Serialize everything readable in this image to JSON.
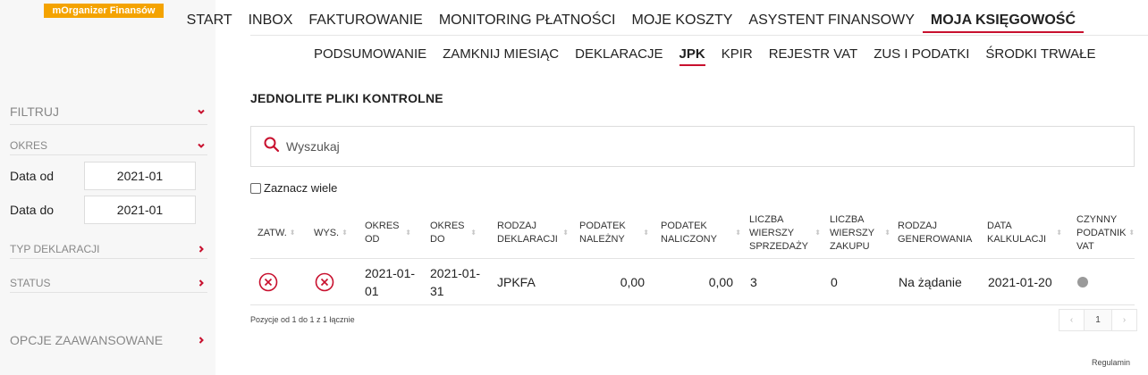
{
  "brand": {
    "logo_text": "mOrganizer Finansów",
    "accent": "#c8102e",
    "logo_color": "#f4a300"
  },
  "sidebar": {
    "filter_label": "FILTRUJ",
    "period_label": "OKRES",
    "date_from_label": "Data od",
    "date_from_value": "2021-01",
    "date_to_label": "Data do",
    "date_to_value": "2021-01",
    "decl_type_label": "TYP DEKLARACJI",
    "status_label": "STATUS",
    "advanced_label": "OPCJE ZAAWANSOWANE"
  },
  "topnav": {
    "items": [
      "START",
      "INBOX",
      "FAKTUROWANIE",
      "MONITORING PŁATNOŚCI",
      "MOJE KOSZTY",
      "ASYSTENT FINANSOWY",
      "MOJA KSIĘGOWOŚĆ"
    ],
    "active": "MOJA KSIĘGOWOŚĆ"
  },
  "subnav": {
    "items": [
      "PODSUMOWANIE",
      "ZAMKNIJ MIESIĄC",
      "DEKLARACJE",
      "JPK",
      "KPIR",
      "REJESTR VAT",
      "ZUS I PODATKI",
      "ŚRODKI TRWAŁE"
    ],
    "active": "JPK"
  },
  "page": {
    "title": "JEDNOLITE PLIKI KONTROLNE",
    "search_placeholder": "Wyszukaj",
    "multi_select_label": "Zaznacz wiele"
  },
  "table": {
    "headers": {
      "zatw": "ZATW.",
      "wys": "WYS.",
      "okres_od": "OKRES OD",
      "okres_do": "OKRES DO",
      "rodzaj": "RODZAJ DEKLARACJI",
      "nalezny": "PODATEK NALEŻNY",
      "naliczony": "PODATEK NALICZONY",
      "sprzedaz": "LICZBA WIERSZY SPRZEDAŻY",
      "zakup": "LICZBA WIERSZY ZAKUPU",
      "generowanie": "RODZAJ GENEROWANIA",
      "kalkulacja": "DATA KALKULACJI",
      "czynny": "CZYNNY PODATNIK VAT"
    },
    "rows": [
      {
        "zatw": "x-circle",
        "wys": "x-circle",
        "okres_od": "2021-01-01",
        "okres_do": "2021-01-31",
        "rodzaj": "JPKFA",
        "nalezny": "0,00",
        "naliczony": "0,00",
        "sprzedaz": "3",
        "zakup": "0",
        "generowanie": "Na żądanie",
        "kalkulacja": "2021-01-20",
        "czynny": "grey-dot"
      }
    ]
  },
  "pagination": {
    "info": "Pozycje od 1 do 1 z 1 łącznie",
    "prev": "‹",
    "current": "1",
    "next": "›"
  },
  "footer": {
    "regulamin": "Regulamin"
  }
}
